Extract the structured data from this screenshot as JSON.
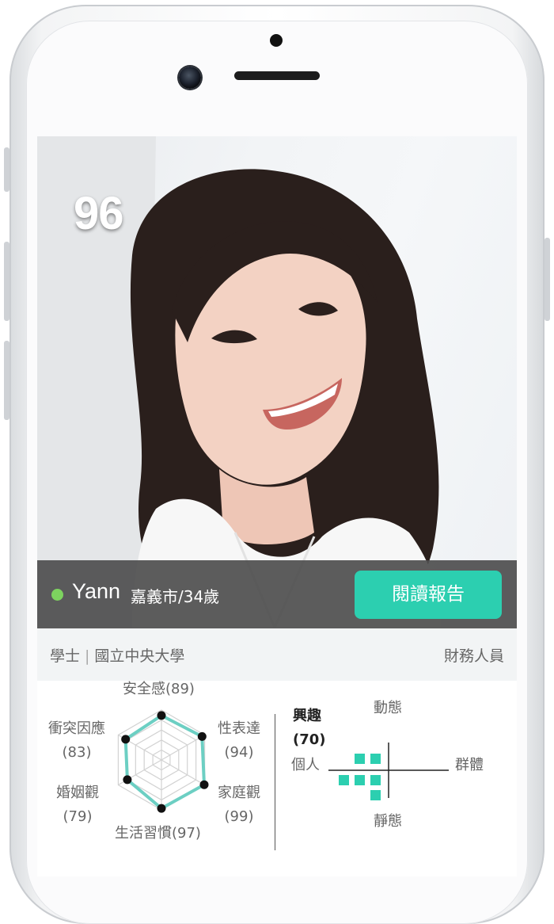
{
  "profile": {
    "score": "96",
    "name": "Yann",
    "city_age": "嘉義市/34歲",
    "report_button": "閱讀報告",
    "education": "學士",
    "school": "國立中央大學",
    "occupation": "財務人員",
    "status_color": "#7dd35f",
    "accent_color": "#2ccfb0"
  },
  "traits": [
    {
      "name": "安全感",
      "score": "(89)",
      "label": "安全感(89)",
      "value": 89
    },
    {
      "name": "性表達",
      "score": "(94)",
      "value": 94
    },
    {
      "name": "家庭觀",
      "score": "(99)",
      "value": 99
    },
    {
      "name": "生活習慣",
      "score": "(97)",
      "label": "生活習慣(97)",
      "value": 97
    },
    {
      "name": "婚姻觀",
      "score": "(79)",
      "value": 79
    },
    {
      "name": "衝突因應",
      "score": "(83)",
      "value": 83
    }
  ],
  "interest": {
    "title": "興趣",
    "score": "(70)",
    "axis_top": "動態",
    "axis_bottom": "靜態",
    "axis_left": "個人",
    "axis_right": "群體"
  }
}
